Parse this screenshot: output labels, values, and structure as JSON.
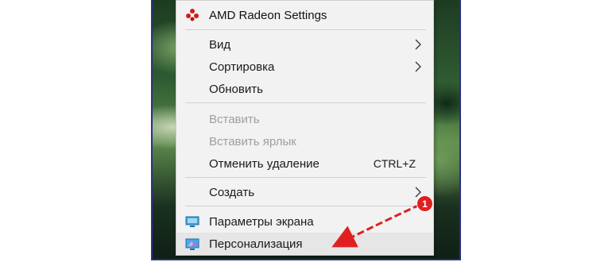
{
  "menu": {
    "header": {
      "label": "AMD Radeon Settings",
      "icon": "amd-radeon-icon"
    },
    "items": [
      {
        "label": "Вид",
        "submenu": true,
        "disabled": false
      },
      {
        "label": "Сортировка",
        "submenu": true,
        "disabled": false
      },
      {
        "label": "Обновить",
        "submenu": false,
        "disabled": false
      },
      {
        "label": "Вставить",
        "submenu": false,
        "disabled": true
      },
      {
        "label": "Вставить ярлык",
        "submenu": false,
        "disabled": true
      },
      {
        "label": "Отменить удаление",
        "shortcut": "CTRL+Z",
        "submenu": false,
        "disabled": false
      },
      {
        "label": "Создать",
        "submenu": true,
        "disabled": false
      },
      {
        "label": "Параметры экрана",
        "icon": "display-icon",
        "disabled": false
      },
      {
        "label": "Персонализация",
        "icon": "personalization-icon",
        "disabled": false,
        "highlighted": true
      }
    ]
  },
  "annotation": {
    "badge_number": "1",
    "arrow_color": "#e02020"
  }
}
